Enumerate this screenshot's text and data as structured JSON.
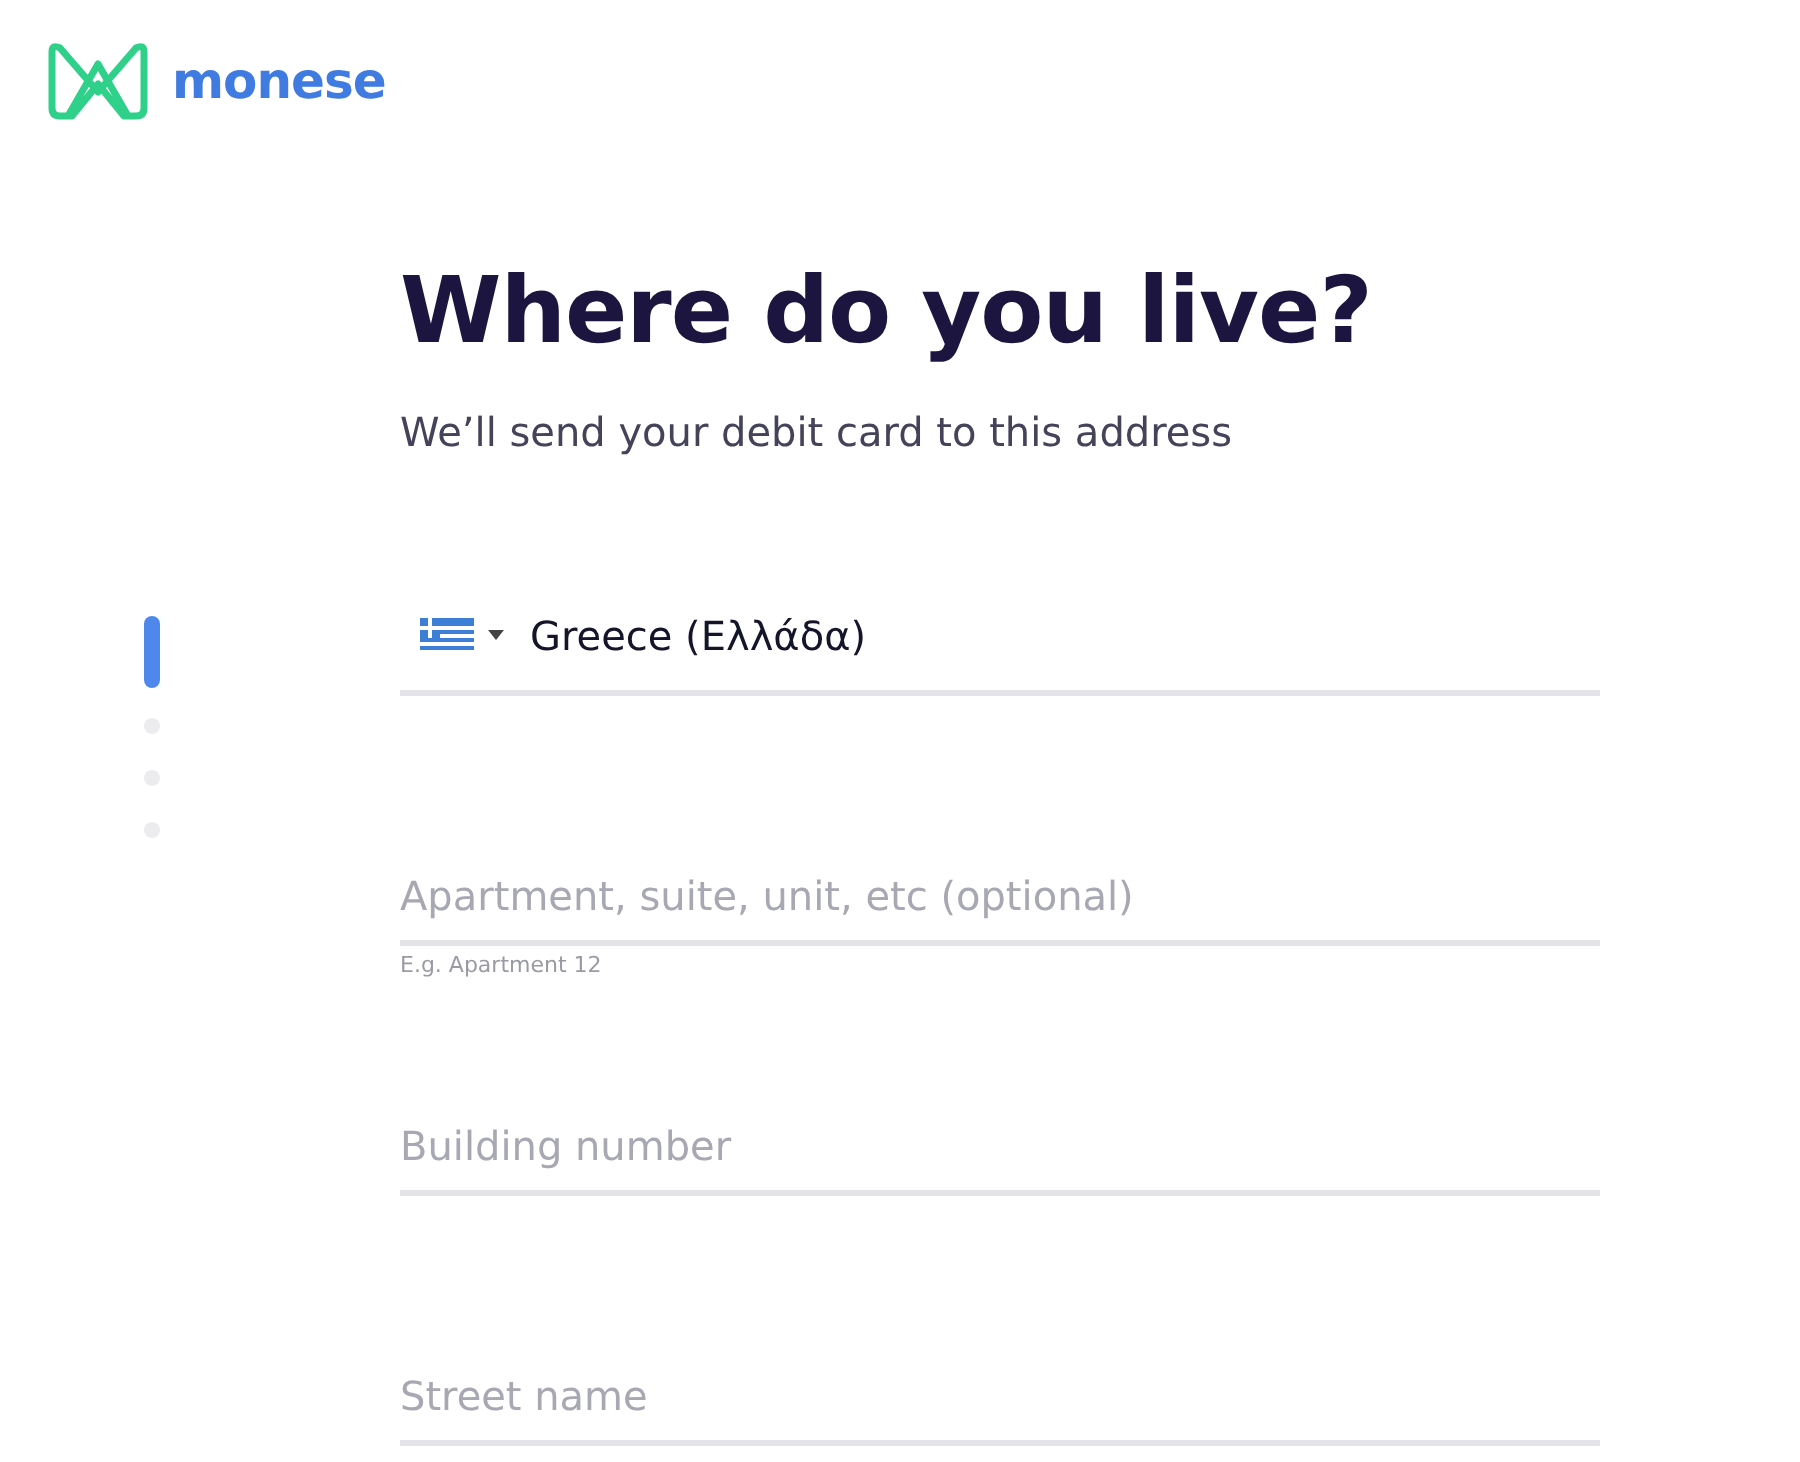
{
  "brand": {
    "name": "monese"
  },
  "heading": "Where do you live?",
  "subtitle": "We’ll send your debit card to this address",
  "steps": [
    {
      "selected": true
    },
    {
      "selected": false
    },
    {
      "selected": false
    },
    {
      "selected": false
    }
  ],
  "country": {
    "value": "Greece (Ελλάδα)"
  },
  "fields": [
    {
      "placeholder": "Apartment, suite, unit, etc (optional)",
      "hint": "E.g. Apartment 12"
    },
    {
      "placeholder": "Building number"
    },
    {
      "placeholder": "Street name"
    }
  ]
}
